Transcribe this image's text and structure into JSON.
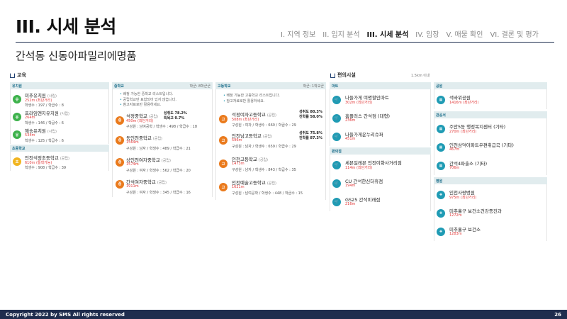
{
  "header": {
    "title": "III. 시세 분석",
    "subtitle": "간석동 신동아파밀리에명품",
    "nav": [
      "I. 지역 정보",
      "II. 입지 분석",
      "III. 시세 분석",
      "IV. 임장",
      "V. 매물 확인",
      "VI. 결론 및 평가"
    ]
  },
  "education": {
    "title": "교육",
    "kinder": {
      "label": "유치원",
      "items": [
        {
          "name": "미추유치원",
          "type": "(사립)",
          "dist": "252m",
          "tag": "(최단거리)",
          "meta": "학생수 : 197 / 학급수 : 8"
        },
        {
          "name": "프라임엔지유치원",
          "type": "(사립)",
          "dist": "264m",
          "meta": "학생수 : 146 / 학급수 : 6"
        },
        {
          "name": "해송유치원",
          "type": "(사립)",
          "dist": "534m",
          "meta": "학생수 : 125 / 학급수 : 6"
        }
      ]
    },
    "elem": {
      "label": "초등학교",
      "items": [
        {
          "name": "인천석정초등학교",
          "type": "(공립)",
          "dist": "610m",
          "tag": "(통학가능)",
          "meta": "학생수 : 908 / 학급수 : 39"
        }
      ]
    },
    "middle": {
      "label": "중학교",
      "right": "학군: 8학군군",
      "notes": [
        "배정 가능한 중학교 리스트입니다.",
        "공립학교만 표함되어 있지 않습니다.",
        "참고자료로만 활용하세요."
      ],
      "items": [
        {
          "name": "석정중학교",
          "type": "(공립)",
          "dist": "450m",
          "tag": "(최단거리)",
          "meta": "구성원 : 남여공학 / 학생수 : 498 / 학급수 : 18",
          "rate1": "성취도 78.2%",
          "rate2": "특목고 0.7%"
        },
        {
          "name": "동인천중학교",
          "type": "(공립)",
          "dist": "1564m",
          "meta": "구성원 : 남자 / 학생수 : 489 / 학급수 : 21"
        },
        {
          "name": "상인천여자중학교",
          "type": "(공립)",
          "dist": "1574m",
          "meta": "구성원 : 여자 / 학생수 : 562 / 학급수 : 20"
        },
        {
          "name": "간석여자중학교",
          "type": "(공립)",
          "dist": "1911m",
          "meta": "구성원 : 여자 / 학생수 : 345 / 학급수 : 16"
        }
      ]
    },
    "high": {
      "label": "고등학교",
      "right": "학군: 1학교군",
      "notes": [
        "배정 가능한 고등학교 리스트입니다.",
        "참고자료로만 활용하세요."
      ],
      "items": [
        {
          "name": "석정여자고등학교",
          "type": "(공립)",
          "dist": "508m",
          "tag": "(최단거리)",
          "meta": "구성원 : 여자 / 학생수 : 660 / 학급수 : 29",
          "rate1": "성취도 80.3%",
          "rate2": "진학률 58.0%"
        },
        {
          "name": "인천남고등학교",
          "type": "(공립)",
          "dist": "596m",
          "meta": "구성원 : 남자 / 학생수 : 659 / 학급수 : 29",
          "rate1": "성취도 75.8%",
          "rate2": "진학률 87.3%"
        },
        {
          "name": "인천고등학교",
          "type": "(공립)",
          "dist": "1473m",
          "meta": "구성원 : 남자 / 학생수 : 843 / 학급수 : 35"
        },
        {
          "name": "인천예술고등학교",
          "type": "(공립)",
          "dist": "1621m",
          "meta": "구성원 : 남여공학 / 학생수 : 448 / 학급수 : 15"
        }
      ]
    }
  },
  "conv": {
    "title": "편의시설",
    "range": "1.5km 이내",
    "mart": {
      "label": "마트",
      "items": [
        {
          "name": "나들가게 여명할인마트",
          "dist": "302m",
          "tag": "(최단거리)"
        },
        {
          "name": "홈플러스 간석점 (대형)",
          "dist": "236m"
        },
        {
          "name": "나들가게운누리슈퍼",
          "dist": "451m"
        }
      ]
    },
    "cvs": {
      "label": "편의점",
      "items": [
        {
          "name": "세븐일레븐 인천이화사거리점",
          "dist": "114m",
          "tag": "(최단거리)"
        },
        {
          "name": "CU 간석한신더휴점",
          "dist": "194m"
        },
        {
          "name": "GS25 간석미래점",
          "dist": "216m"
        }
      ]
    },
    "park": {
      "label": "공원",
      "items": [
        {
          "name": "석바위공원",
          "dist": "1416m",
          "tag": "(최단거리)"
        }
      ]
    },
    "office": {
      "label": "관공서",
      "items": [
        {
          "name": "주안5동 행정복지센터 (기타)",
          "dist": "270m",
          "tag": "(최단거리)"
        },
        {
          "name": "인천삼덕아파트우편취급국 (기타)",
          "dist": "467m"
        },
        {
          "name": "간석4파출소 (기타)",
          "dist": "706m"
        }
      ]
    },
    "hospital": {
      "label": "병원",
      "items": [
        {
          "name": "인천사랑병원",
          "dist": "975m",
          "tag": "(최단거리)"
        },
        {
          "name": "미추홀구 보건소건강증진과",
          "dist": "1272m"
        },
        {
          "name": "미추홀구 보건소",
          "dist": "1283m"
        }
      ]
    }
  },
  "footer": {
    "copyright": "Copyright 2022 by SMS All rights reserved",
    "page": "26"
  }
}
